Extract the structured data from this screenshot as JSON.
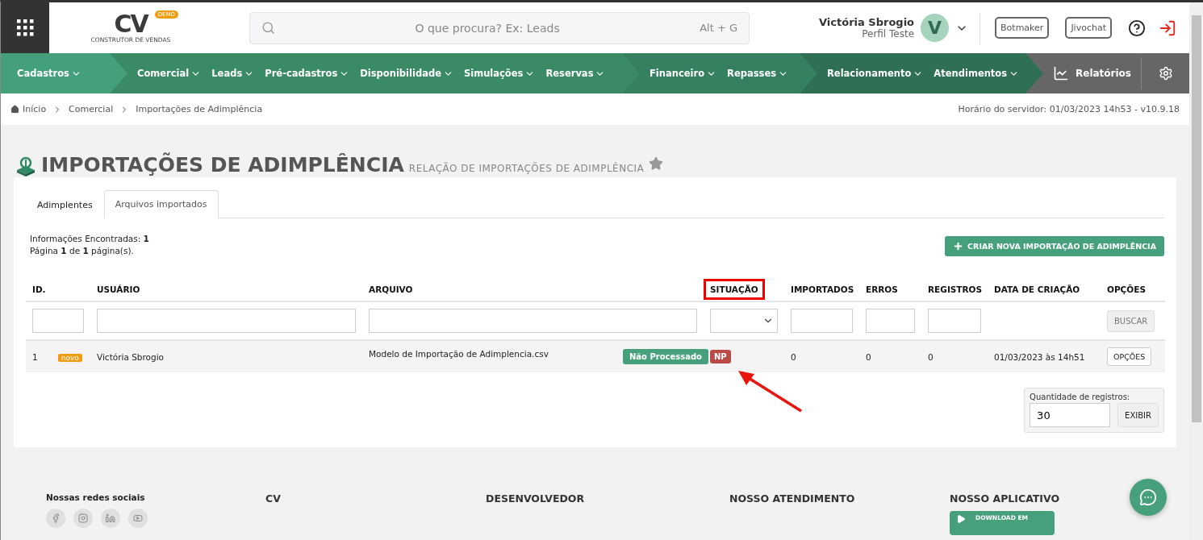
{
  "header": {
    "logo": {
      "mark": "CV",
      "badge": "DEMO",
      "tagline": "CONSTRUTOR DE VENDAS"
    },
    "search": {
      "placeholder": "O que procura? Ex: Leads",
      "shortcut": "Alt + G"
    },
    "user": {
      "name": "Victória Sbrogio",
      "profile": "Perfil Teste",
      "initial": "V"
    },
    "buttons": [
      "Botmaker",
      "Jivochat"
    ]
  },
  "nav": [
    {
      "items": [
        "Cadastros"
      ]
    },
    {
      "items": [
        "Comercial",
        "Leads",
        "Pré-cadastros",
        "Disponibilidade",
        "Simulações",
        "Reservas"
      ]
    },
    {
      "items": [
        "Financeiro",
        "Repasses"
      ]
    },
    {
      "items": [
        "Relacionamento",
        "Atendimentos"
      ]
    }
  ],
  "reports": "Relatórios",
  "breadcrumb": [
    "Início",
    "Comercial",
    "Importações de Adimplência"
  ],
  "server_time": "Horário do servidor: 01/03/2023 14h53 - v10.9.18",
  "page": {
    "title": "IMPORTAÇÕES DE ADIMPLÊNCIA",
    "subtitle": "RELAÇÃO DE IMPORTAÇÕES DE ADIMPLÊNCIA"
  },
  "tabs": [
    {
      "label": "Adimplentes",
      "selected": false
    },
    {
      "label": "Arquivos importados",
      "selected": true
    }
  ],
  "summary": [
    "Informações Encontradas: **1**",
    "Página **1** de **1** página(s)."
  ],
  "create_button": "CRIAR NOVA IMPORTAÇÃO DE ADIMPLÊNCIA",
  "table": {
    "columns": [
      {
        "label": "ID.",
        "kind": "text",
        "highlighted": false
      },
      {
        "label": "USUÁRIO",
        "kind": "text",
        "highlighted": false
      },
      {
        "label": "ARQUIVO",
        "kind": "text",
        "highlighted": false
      },
      {
        "label": "SITUAÇÃO",
        "kind": "select",
        "highlighted": true
      },
      {
        "label": "IMPORTADOS",
        "kind": "text",
        "highlighted": false
      },
      {
        "label": "ERROS",
        "kind": "text",
        "highlighted": false
      },
      {
        "label": "REGISTROS",
        "kind": "text",
        "highlighted": false
      },
      {
        "label": "DATA DE CRIAÇÃO",
        "kind": "none",
        "highlighted": false
      },
      {
        "label": "OPÇÕES",
        "kind": "button",
        "highlighted": false
      }
    ],
    "filter_button": "BUSCAR",
    "rows": [
      {
        "id": "1",
        "badge": "novo",
        "user": "Victória Sbrogio",
        "file": "Modelo de Importação de Adimplencia.csv",
        "status_label": "Não Processado",
        "status_code": "NP",
        "imported": "0",
        "errors": "0",
        "records": "0",
        "created": "01/03/2023 às 14h51",
        "options": "OPÇÕES"
      }
    ]
  },
  "page_size": {
    "label": "Quantidade de registros:",
    "value": "30",
    "button": "EXIBIR"
  },
  "footer": {
    "social_title": "Nossas redes sociais",
    "columns": [
      "CV",
      "DESENVOLVEDOR",
      "NOSSO ATENDIMENTO",
      "NOSSO APLICATIVO"
    ],
    "app_badge": "DOWNLOAD EM"
  }
}
